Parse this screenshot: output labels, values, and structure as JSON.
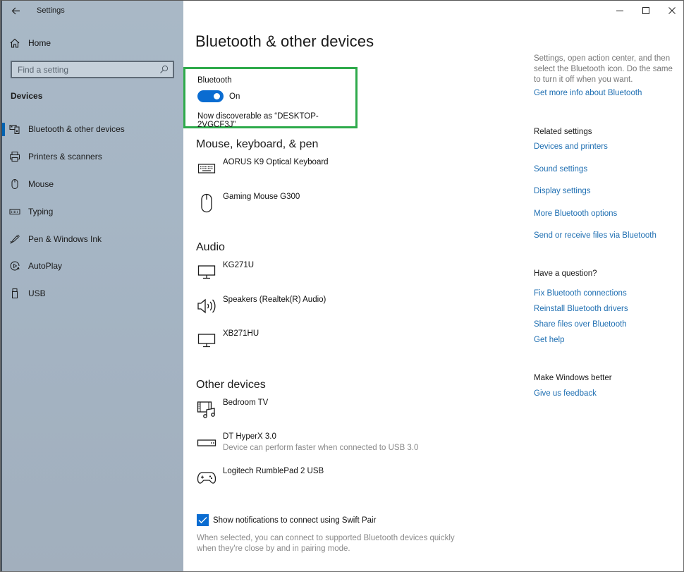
{
  "window": {
    "title": "Settings",
    "controls": {
      "minimize": "minimize-icon",
      "maximize": "maximize-icon",
      "close": "close-icon"
    }
  },
  "sidebar": {
    "home_label": "Home",
    "search_placeholder": "Find a setting",
    "section": "Devices",
    "items": [
      {
        "label": "Bluetooth & other devices",
        "icon": "bluetooth-devices-icon",
        "active": true
      },
      {
        "label": "Printers & scanners",
        "icon": "printer-icon",
        "active": false
      },
      {
        "label": "Mouse",
        "icon": "mouse-icon",
        "active": false
      },
      {
        "label": "Typing",
        "icon": "keyboard-icon",
        "active": false
      },
      {
        "label": "Pen & Windows Ink",
        "icon": "pen-icon",
        "active": false
      },
      {
        "label": "AutoPlay",
        "icon": "autoplay-icon",
        "active": false
      },
      {
        "label": "USB",
        "icon": "usb-icon",
        "active": false
      }
    ]
  },
  "main": {
    "title": "Bluetooth & other devices",
    "bluetooth": {
      "label": "Bluetooth",
      "state": "On",
      "enabled": true,
      "discoverable": "Now discoverable as “DESKTOP-2VGCF3J”",
      "highlight_color": "#2eaa4b"
    },
    "groups": [
      {
        "title": "Mouse, keyboard, & pen",
        "devices": [
          {
            "name": "AORUS K9 Optical Keyboard",
            "icon": "keyboard-icon"
          },
          {
            "name": "Gaming Mouse G300",
            "icon": "mouse-icon"
          }
        ]
      },
      {
        "title": "Audio",
        "devices": [
          {
            "name": "KG271U",
            "icon": "monitor-icon"
          },
          {
            "name": "Speakers (Realtek(R) Audio)",
            "icon": "speaker-icon"
          },
          {
            "name": "XB271HU",
            "icon": "monitor-icon"
          }
        ]
      },
      {
        "title": "Other devices",
        "devices": [
          {
            "name": "Bedroom TV",
            "icon": "media-device-icon"
          },
          {
            "name": "DT HyperX 3.0",
            "sub": "Device can perform faster when connected to USB 3.0",
            "icon": "usb-drive-icon"
          },
          {
            "name": "Logitech RumblePad 2 USB",
            "icon": "gamepad-icon"
          }
        ]
      }
    ],
    "swift_pair": {
      "checked": true,
      "label": "Show notifications to connect using Swift Pair",
      "description": "When selected, you can connect to supported Bluetooth devices quickly when they're close by and in pairing mode."
    }
  },
  "right": {
    "info_text": "Settings, open action center, and then select the Bluetooth icon. Do the same to turn it off when you want.",
    "info_link": "Get more info about Bluetooth",
    "related_title": "Related settings",
    "related_links": [
      "Devices and printers",
      "Sound settings",
      "Display settings",
      "More Bluetooth options",
      "Send or receive files via Bluetooth"
    ],
    "question_title": "Have a question?",
    "question_links": [
      "Fix Bluetooth connections",
      "Reinstall Bluetooth drivers",
      "Share files over Bluetooth",
      "Get help"
    ],
    "better_title": "Make Windows better",
    "better_link": "Give us feedback"
  },
  "colors": {
    "accent": "#0a6cd1",
    "link": "#1f6fb2",
    "highlight": "#2eaa4b"
  }
}
